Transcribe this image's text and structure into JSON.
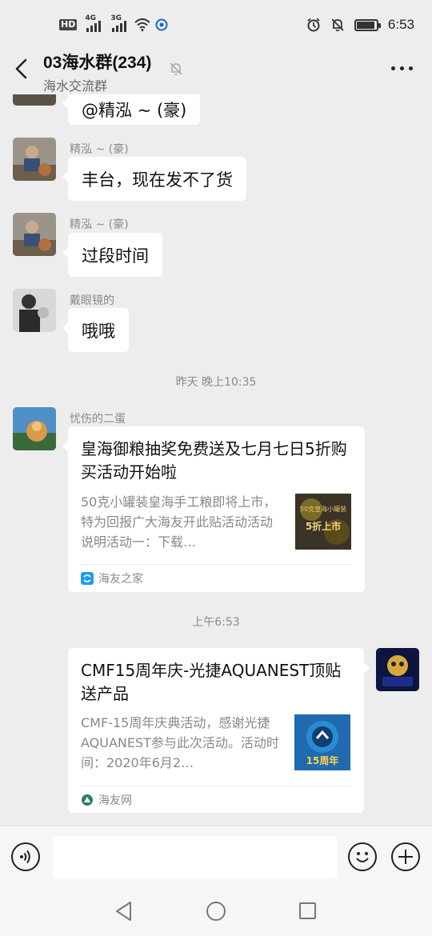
{
  "status_bar": {
    "hd_label": "HD",
    "network_1": "4G",
    "network_2": "3G",
    "battery_level": 0.9,
    "time": "6:53"
  },
  "header": {
    "title": "03海水群(234)",
    "subtitle": "海水交流群"
  },
  "messages": [
    {
      "sender": "",
      "text": "@精泓 ~ (豪)"
    },
    {
      "sender": "精泓 ~ (豪)",
      "text": "丰台，现在发不了货"
    },
    {
      "sender": "精泓 ~ (豪)",
      "text": "过段时间"
    },
    {
      "sender": "戴眼镜的",
      "text": "哦哦"
    }
  ],
  "timestamps": [
    "昨天 晚上10:35",
    "上午6:53"
  ],
  "card_left": {
    "sender": "忧伤的二蛋",
    "title": "皇海御粮抽奖免费送及七月七日5折购买活动开始啦",
    "desc": "50克小罐装皇海手工粮即将上市，特为回报广大海友开此贴活动活动说明活动一：下载…",
    "thumb_text_1": "50克皇海小罐装",
    "thumb_text_2": "5折上市",
    "source": "海友之家"
  },
  "card_right": {
    "title": "CMF15周年庆-光捷AQUANEST顶贴送产品",
    "desc": "CMF-15周年庆典活动，感谢光捷AQUANEST参与此次活动。活动时间：2020年6月2…",
    "thumb_text": "15周年",
    "source": "海友网"
  },
  "input_bar": {
    "placeholder": ""
  },
  "colors": {
    "background": "#ededed",
    "bubble": "#ffffff",
    "accent_blue": "#1aa0e6"
  }
}
